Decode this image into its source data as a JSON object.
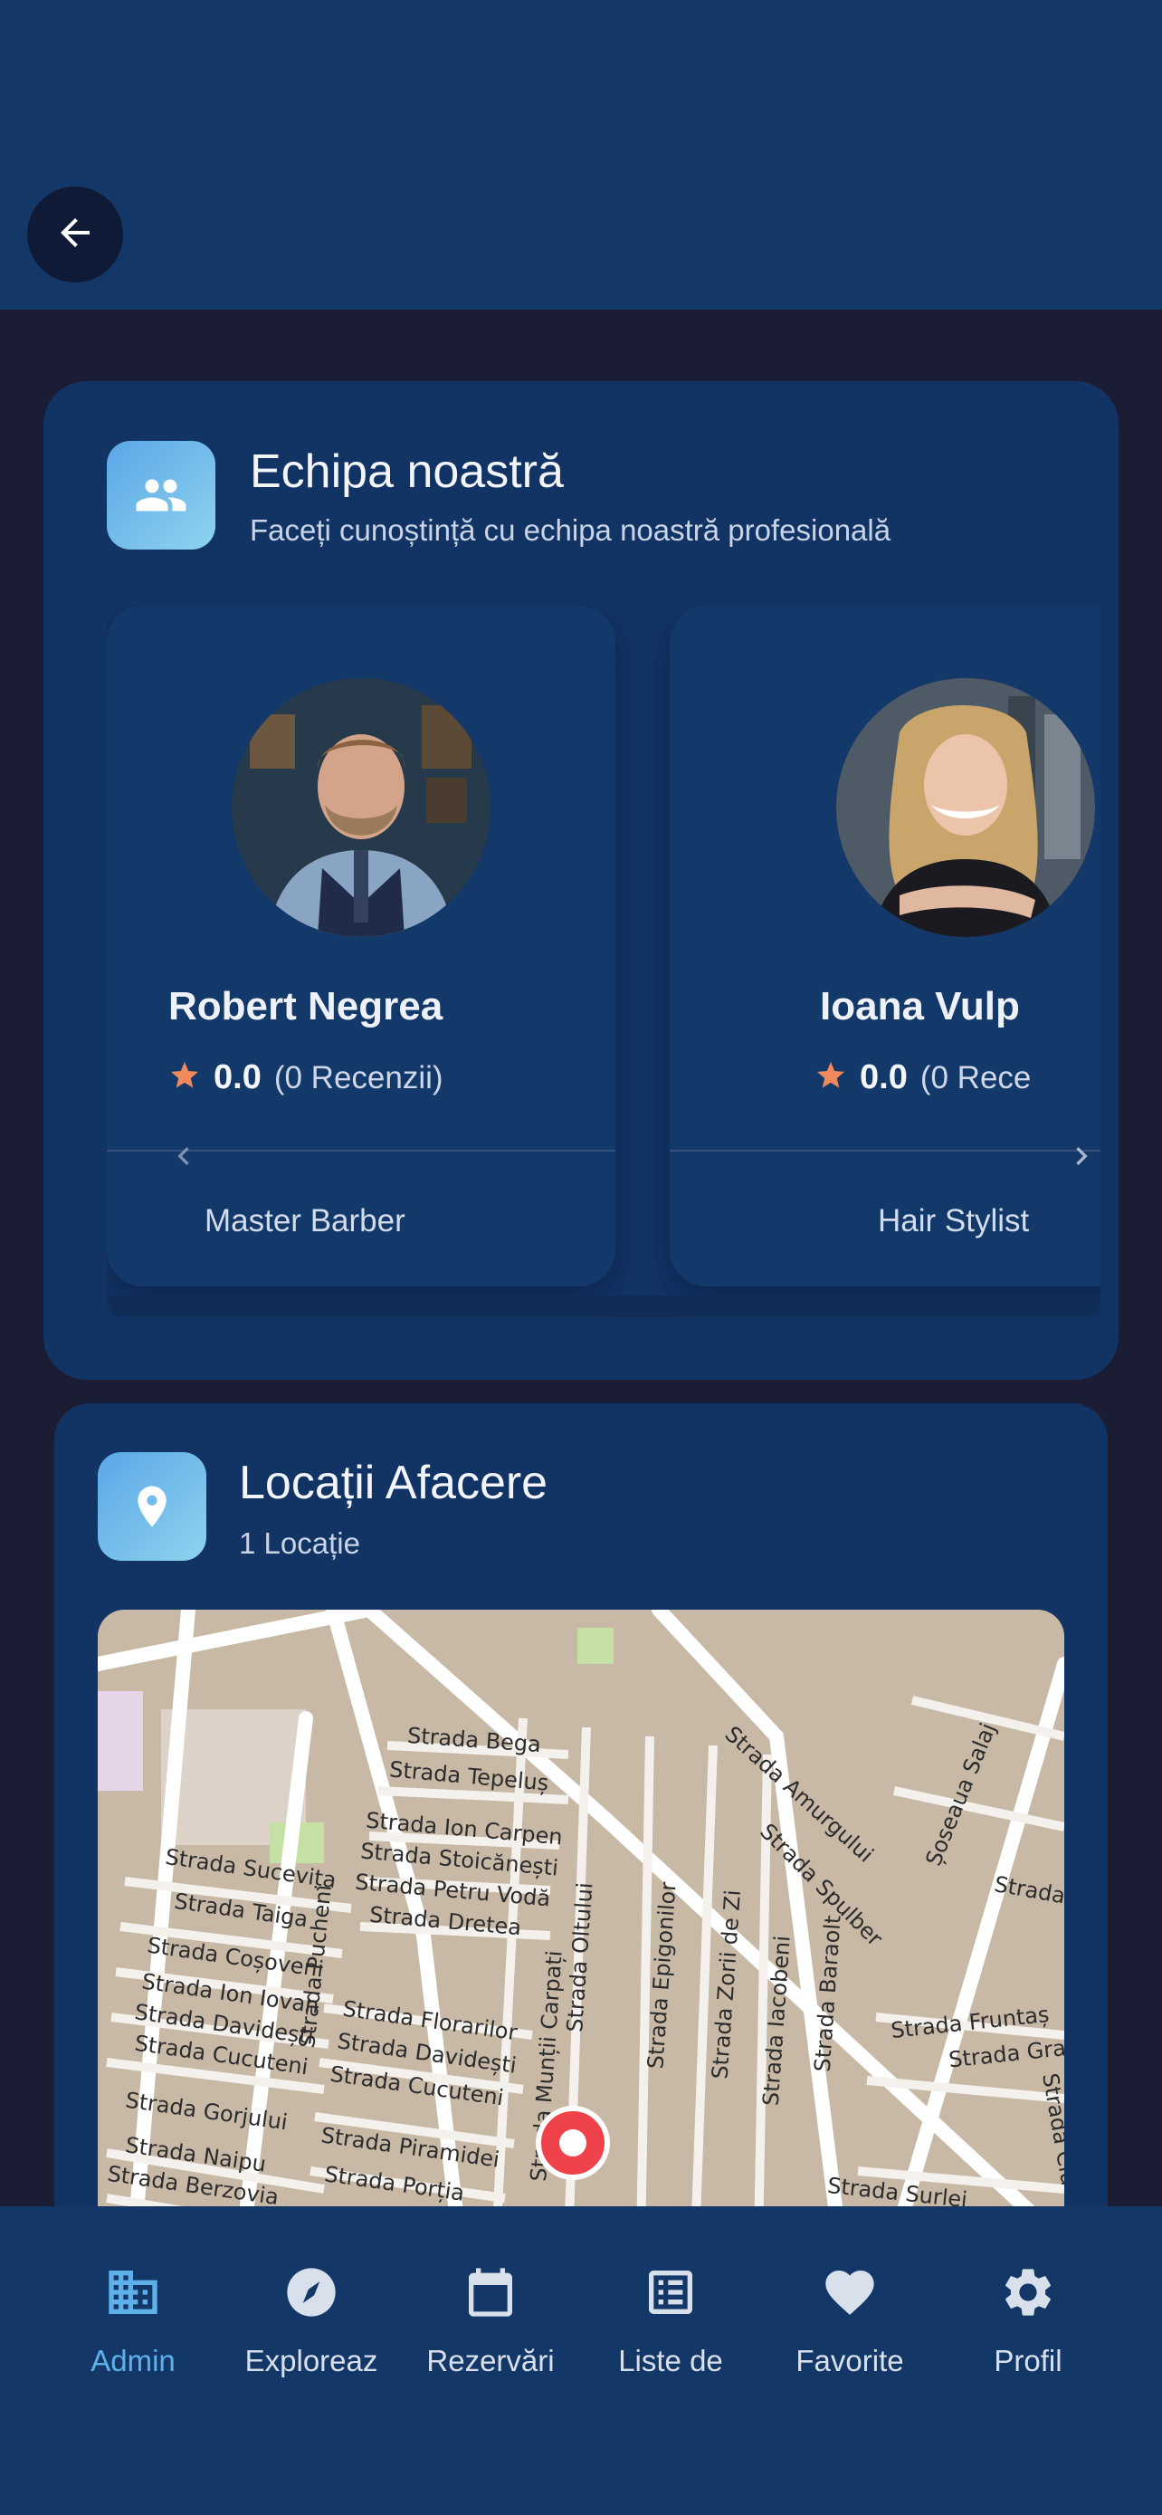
{
  "header": {
    "back_icon": "arrow-left-icon"
  },
  "team": {
    "icon": "people-icon",
    "title": "Echipa noastră",
    "subtitle": "Faceți cunoștință cu echipa noastră profesională",
    "prev_icon": "chevron-left-icon",
    "next_icon": "chevron-right-icon",
    "members": [
      {
        "name": "Robert Negrea",
        "score": "0.0",
        "reviews": "(0 Recenzii)",
        "role": "Master Barber",
        "star_color": "#f08a5d"
      },
      {
        "name": "Ioana Vulp",
        "score": "0.0",
        "reviews": "(0 Rece",
        "role": "Hair Stylist",
        "star_color": "#f08a5d"
      }
    ]
  },
  "locations": {
    "icon": "map-pin-icon",
    "title": "Locații Afacere",
    "subtitle": "1 Locație",
    "map": {
      "marker_color": "#f0424a",
      "streets": [
        "Strada Bega",
        "Strada Tepeluș",
        "Strada Ion Carpen",
        "Strada Stoicănești",
        "Strada Petru Vodă",
        "Strada Dretea",
        "Strada Sucevița",
        "Strada Taiga",
        "Strada Coșoveni",
        "Strada Ion Iovan",
        "Strada Davidești",
        "Strada Cucuteni",
        "Strada Gorjului",
        "Strada Naipu",
        "Strada Berzovia",
        "Strada Pucheni",
        "Strada Florarilor",
        "Strada Davidești",
        "Strada Cucuteni",
        "Strada Piramidei",
        "Strada Porția",
        "Strada Munții Carpați",
        "Strada Oltului",
        "Strada Epigonilor",
        "Strada Zorii de Zi",
        "Strada Iacobeni",
        "Strada Baraolt",
        "Strada Amurgului",
        "Strada Spulber",
        "Șoseaua Salaj",
        "Strada Surlei",
        "Strada Fruntaș",
        "Strada Grap",
        "Strada Luc",
        "Strada Clu"
      ]
    }
  },
  "nav": {
    "active_color": "#5fb0ea",
    "items": [
      {
        "label": "Admin",
        "icon": "building-icon",
        "active": true
      },
      {
        "label": "Exploreaz",
        "icon": "compass-icon",
        "active": false
      },
      {
        "label": "Rezervări",
        "icon": "calendar-icon",
        "active": false
      },
      {
        "label": "Liste de",
        "icon": "list-icon",
        "active": false
      },
      {
        "label": "Favorite",
        "icon": "heart-icon",
        "active": false
      },
      {
        "label": "Profil",
        "icon": "gear-icon",
        "active": false
      }
    ]
  }
}
